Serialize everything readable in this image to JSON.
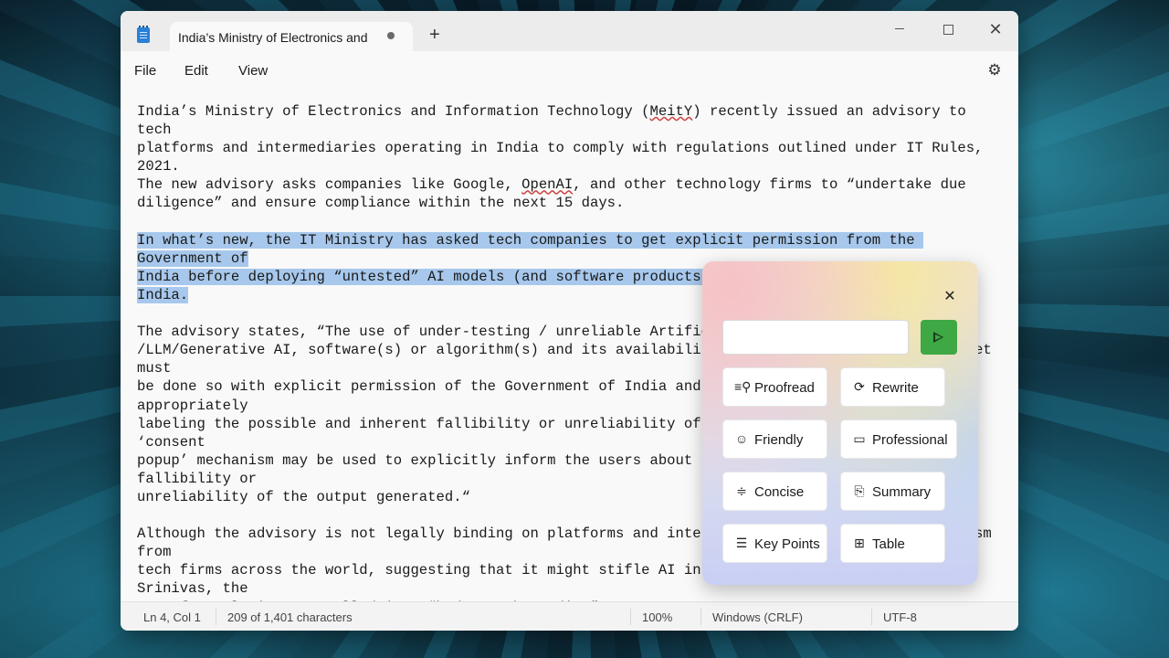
{
  "window": {
    "tab_title": "India’s Ministry of Electronics and",
    "new_tab": "+",
    "minimize": "",
    "maximize": "",
    "close": "✕"
  },
  "menu": {
    "file": "File",
    "edit": "Edit",
    "view": "View",
    "settings_icon": "gear-icon"
  },
  "document": {
    "p1": [
      "India’s Ministry of Electronics and Information Technology (",
      "MeitY",
      ") recently issued an advisory to tech\nplatforms and intermediaries operating in India to comply with regulations outlined under IT Rules, 2021.\nThe new advisory asks companies like Google, ",
      "OpenAI",
      ", and other technology firms to “undertake due\ndiligence” and ensure compliance within the next 15 days."
    ],
    "p2": "In what’s new, the IT Ministry has asked tech companies to get explicit permission from the Government of\nIndia before deploying “untested” AI models (and software products developed on such models) in India.",
    "p3": "The advisory states, “The use of under-testing / unreliable Artificial Intelligence model(s)\n/LLM/Generative AI, software(s) or algorithm(s) and its availability to the users on Indian Internet must\nbe done so with explicit permission of the Government of India and be deployed only after appropriately\nlabeling the possible and inherent fallibility or unreliability of the output generated. Further, ‘consent\npopup’ mechanism may be used to explicitly inform the users about the possible and inherent fallibility or\nunreliability of the output generated.“",
    "p4": "Although the advisory is not legally binding on platforms and intermediaries, it has drawn criticism from\ntech firms across the world, suggesting that it might stifle AI innovation in India. Aravind Srinivas, the\nCEO of Perplexity AI, called it a “bad move by India.”"
  },
  "status": {
    "position": "Ln 4, Col 1",
    "characters": "209 of 1,401 characters",
    "zoom": "100%",
    "line_ending": "Windows (CRLF)",
    "encoding": "UTF-8"
  },
  "ai_panel": {
    "close": "✕",
    "input_value": "",
    "input_placeholder": "",
    "actions": [
      {
        "label": "Proofread",
        "icon": "proofread-icon",
        "glyph": "≡⚲"
      },
      {
        "label": "Rewrite",
        "icon": "rewrite-icon",
        "glyph": "⟳"
      },
      {
        "label": "Friendly",
        "icon": "smiley-icon",
        "glyph": "☺"
      },
      {
        "label": "Professional",
        "icon": "briefcase-icon",
        "glyph": "▭"
      },
      {
        "label": "Concise",
        "icon": "concise-icon",
        "glyph": "≑"
      },
      {
        "label": "Summary",
        "icon": "summary-icon",
        "glyph": "⎘"
      },
      {
        "label": "Key Points",
        "icon": "list-icon",
        "glyph": "☰"
      },
      {
        "label": "Table",
        "icon": "table-icon",
        "glyph": "⊞"
      }
    ],
    "accent": "#3ea845"
  }
}
